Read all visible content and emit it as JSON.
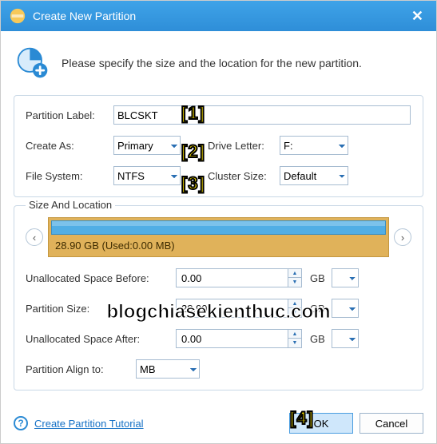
{
  "title": "Create New Partition",
  "close_glyph": "✕",
  "intro": "Please specify the size and the location for the new partition.",
  "form": {
    "label_lbl": "Partition Label:",
    "label_value": "BLCSKT",
    "create_as_lbl": "Create As:",
    "create_as_value": "Primary",
    "drive_letter_lbl": "Drive Letter:",
    "drive_letter_value": "F:",
    "fs_lbl": "File System:",
    "fs_value": "NTFS",
    "cluster_lbl": "Cluster Size:",
    "cluster_value": "Default"
  },
  "size_loc": {
    "legend": "Size And Location",
    "caption": "28.90 GB (Used:0.00 MB)",
    "before_lbl": "Unallocated Space Before:",
    "before_val": "0.00",
    "psize_lbl": "Partition Size:",
    "psize_val": "28.90",
    "after_lbl": "Unallocated Space After:",
    "after_val": "0.00",
    "unit": "GB",
    "align_lbl": "Partition Align to:",
    "align_val": "MB"
  },
  "footer": {
    "tutorial": "Create Partition Tutorial",
    "ok": "OK",
    "cancel": "Cancel"
  },
  "annotations": {
    "a1": "[1]",
    "a2": "[2]",
    "a3": "[3]",
    "a4": "[4]",
    "watermark": "blogchiasekienthuc.com"
  }
}
